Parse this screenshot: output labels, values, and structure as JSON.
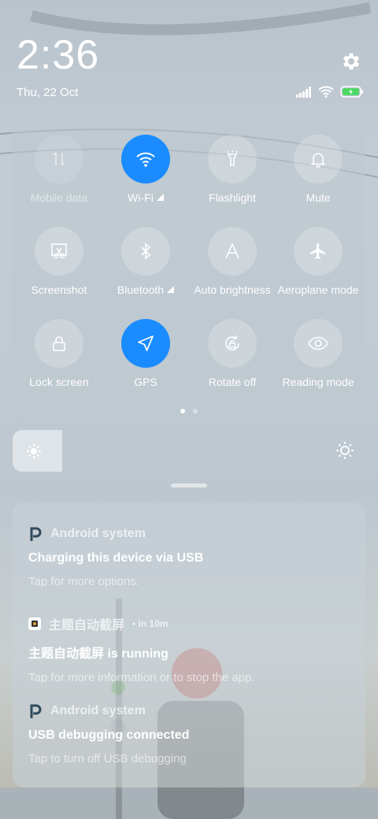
{
  "status_bar": {
    "time": "2:36",
    "date": "Thu, 22 Oct"
  },
  "quick_settings": {
    "tiles": [
      {
        "label": "Mobile data",
        "icon": "mobile-data-icon",
        "state": "disabled"
      },
      {
        "label": "Wi-Fi",
        "icon": "wifi-icon",
        "state": "on"
      },
      {
        "label": "Flashlight",
        "icon": "flashlight-icon",
        "state": "off"
      },
      {
        "label": "Mute",
        "icon": "bell-icon",
        "state": "off"
      },
      {
        "label": "Screenshot",
        "icon": "screenshot-icon",
        "state": "off"
      },
      {
        "label": "Bluetooth",
        "icon": "bluetooth-icon",
        "state": "off"
      },
      {
        "label": "Auto brightness",
        "icon": "auto-brightness-icon",
        "state": "off"
      },
      {
        "label": "Aeroplane mode",
        "icon": "airplane-icon",
        "state": "off"
      },
      {
        "label": "Lock screen",
        "icon": "lock-icon",
        "state": "off"
      },
      {
        "label": "GPS",
        "icon": "gps-icon",
        "state": "on"
      },
      {
        "label": "Rotate off",
        "icon": "rotate-icon",
        "state": "off"
      },
      {
        "label": "Reading mode",
        "icon": "eye-icon",
        "state": "off"
      }
    ],
    "page_count": 2,
    "current_page": 1
  },
  "brightness": {
    "level": 0.14
  },
  "notifications": [
    {
      "app": "Android system",
      "time": "",
      "title": "Charging this device via USB",
      "body": "Tap for more options."
    },
    {
      "app": "主题自动截屏",
      "time": "• in 10m",
      "title": "主题自动截屏 is running",
      "body": "Tap for more information or to stop the app."
    },
    {
      "app": "Android system",
      "time": "",
      "title": "USB debugging connected",
      "body": "Tap to turn off USB debugging"
    }
  ],
  "colors": {
    "accent": "#1a8cff",
    "battery": "#4cd964"
  }
}
